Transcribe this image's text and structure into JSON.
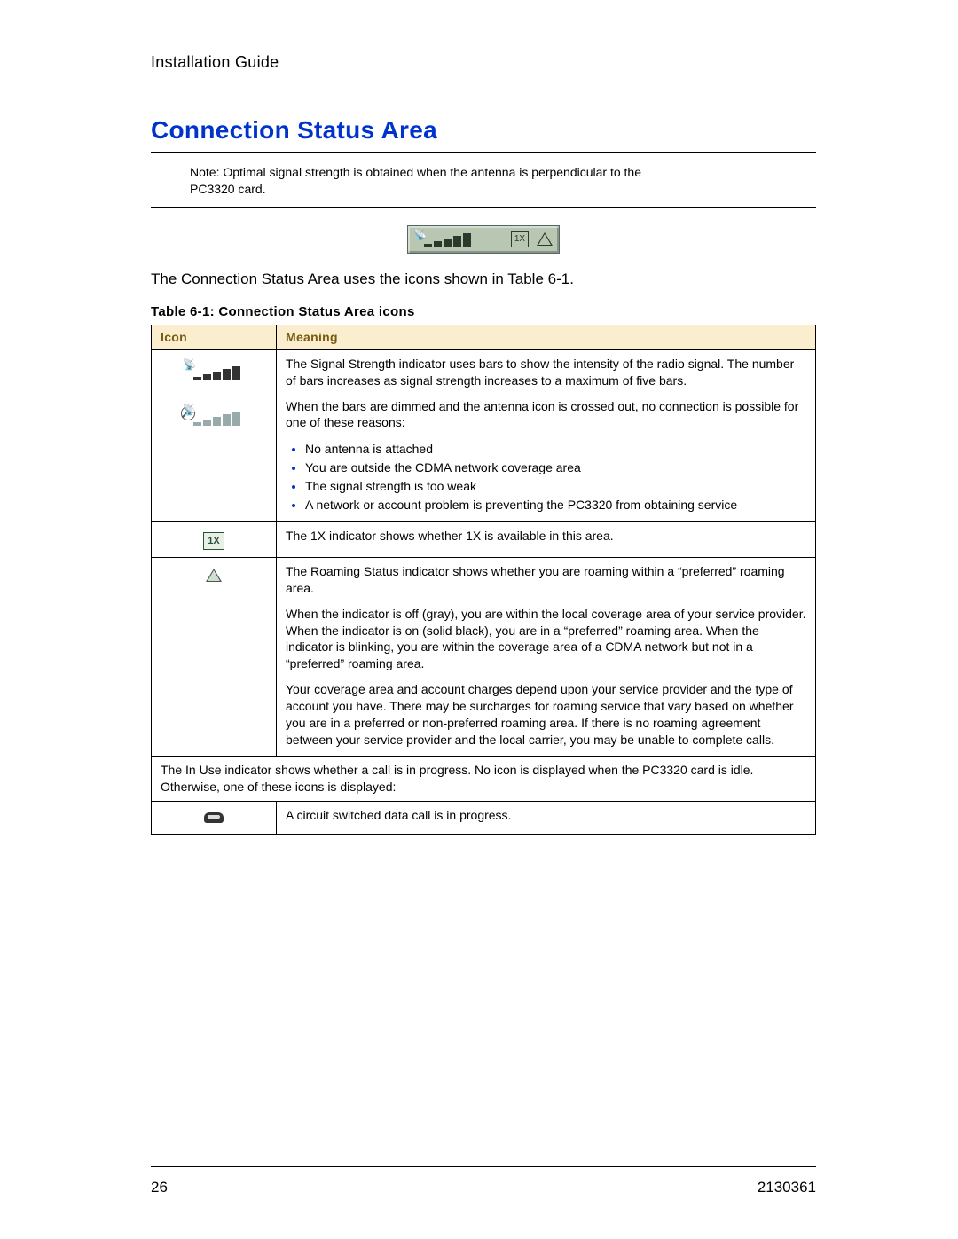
{
  "header": {
    "doc_title": "Installation Guide"
  },
  "section": {
    "title": "Connection Status Area",
    "note_label": "Note:",
    "note_text": "Optimal signal strength is obtained when the antenna is perpendicular to the PC3320 card.",
    "intro": "The Connection Status Area uses the icons shown in Table 6-1.",
    "table_caption": "Table 6-1: Connection Status Area icons"
  },
  "table": {
    "headers": {
      "icon": "Icon",
      "meaning": "Meaning"
    },
    "rows": {
      "signal": {
        "p1": "The Signal Strength indicator uses bars to show the intensity of the radio signal. The number of bars increases as signal strength increases to a maximum of five bars.",
        "p2": "When the bars are dimmed and the antenna icon is crossed out, no connection is possible for one of these reasons:",
        "bullets": [
          "No antenna is attached",
          "You are outside the CDMA network coverage area",
          "The signal strength is too weak",
          "A network or account problem is preventing the PC3320 from obtaining service"
        ]
      },
      "onex": "The 1X indicator shows whether 1X is available in this area.",
      "roaming": {
        "p1": "The Roaming Status indicator shows whether you are roaming within a “preferred” roaming area.",
        "p2": "When the indicator is off (gray), you are within the local coverage area of your service provider. When the indicator is on (solid black), you are in a “preferred” roaming area. When the indicator is blinking, you are within the coverage area of a CDMA network but not in a “preferred” roaming area.",
        "p3": "Your coverage area and account charges depend upon your service provider and the type of account you have. There may be surcharges for roaming service that vary based on whether you are in a preferred or non-preferred roaming area. If there is no roaming agreement between your service provider and the local carrier, you may be unable to complete calls."
      },
      "inuse_intro": "The In Use indicator shows whether a call is in progress. No icon is displayed when the PC3320 card is idle. Otherwise, one of these icons is displayed:",
      "inuse_circuit": "A circuit switched data call is in progress."
    }
  },
  "footer": {
    "page": "26",
    "docnum": "2130361"
  }
}
